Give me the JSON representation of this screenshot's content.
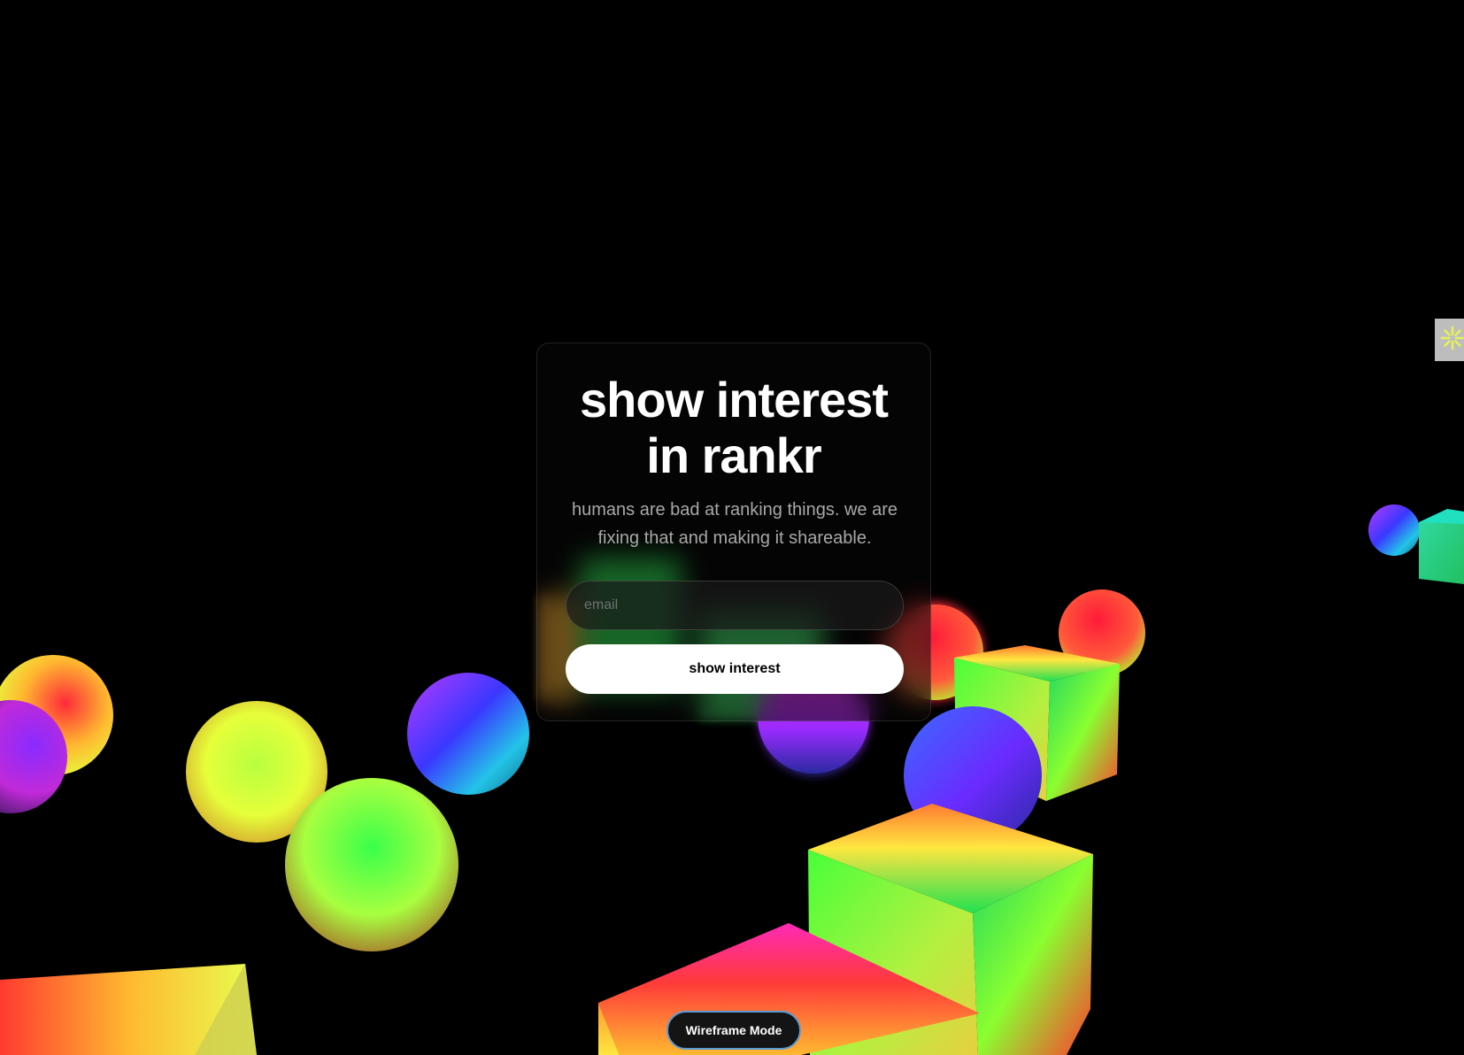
{
  "card": {
    "title_line1": "show interest",
    "title_line2": "in rankr",
    "subtitle": "humans are bad at ranking things. we are fixing that and making it shareable.",
    "email_placeholder": "email",
    "email_value": "",
    "submit_label": "show interest"
  },
  "wireframe_toggle": {
    "label": "Wireframe Mode",
    "border_color": "#5a9bd5"
  },
  "side_widget": {
    "icon": "sparkle-icon",
    "icon_color": "#e6f05a"
  },
  "scene": {
    "background": "#000000",
    "shapes": [
      "sphere",
      "sphere",
      "sphere",
      "sphere",
      "sphere",
      "sphere",
      "sphere",
      "sphere",
      "sphere",
      "sphere",
      "cube",
      "cube",
      "cube",
      "cube",
      "cube",
      "pyramid"
    ]
  }
}
